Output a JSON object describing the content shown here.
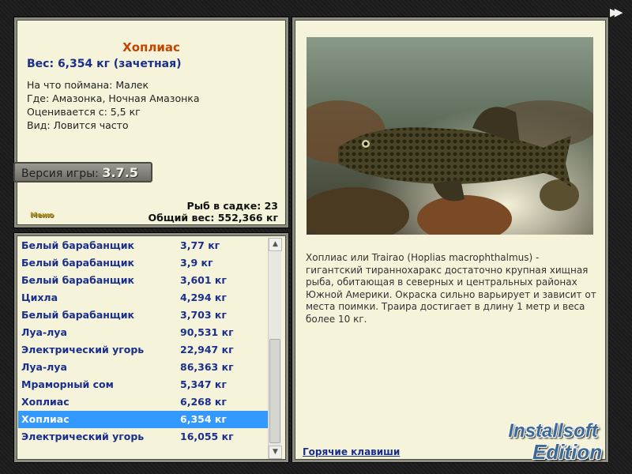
{
  "fish": {
    "name": "Хоплиас",
    "weight_line": "Вес: 6,354 кг (зачетная)",
    "caught_on": "На что поймана: Малек",
    "location": "Где: Амазонка, Ночная Амазонка",
    "valued_from": "Оценивается с: 5,5 кг",
    "kind": "Вид: Ловится часто"
  },
  "version": {
    "label": "Версия игры:",
    "number": "3.7.5"
  },
  "menu_label": "Меню",
  "stats": {
    "fish_in_tank": "Рыб в садке: 23",
    "total_weight": "Общий вес: 552,366 кг"
  },
  "catch_list": [
    {
      "name": "Белый барабанщик",
      "weight": "3,77 кг"
    },
    {
      "name": "Белый барабанщик",
      "weight": "3,9 кг"
    },
    {
      "name": "Белый барабанщик",
      "weight": "3,601 кг"
    },
    {
      "name": "Цихла",
      "weight": "4,294 кг"
    },
    {
      "name": "Белый барабанщик",
      "weight": "3,703 кг"
    },
    {
      "name": "Луа-луа",
      "weight": "90,531 кг"
    },
    {
      "name": "Электрический угорь",
      "weight": "22,947 кг"
    },
    {
      "name": "Луа-луа",
      "weight": "86,363 кг"
    },
    {
      "name": "Мраморный сом",
      "weight": "5,347 кг"
    },
    {
      "name": "Хоплиас",
      "weight": "6,268 кг"
    },
    {
      "name": "Хоплиас",
      "weight": "6,354 кг"
    },
    {
      "name": "Электрический угорь",
      "weight": "16,055 кг"
    }
  ],
  "selected_index": 10,
  "description": "Хоплиас или Trairao (Hoplias macrophthalmus) - гигантский тираннохаракс достаточно крупная хищная рыба, обитающая в северных и центральных районах Южной Америки. Окраска сильно варьирует и зависит от места поимки. Траира достигает в длину 1 метр и веса более 10 кг.",
  "hotkeys_link": "Горячие клавиши",
  "watermark": {
    "line1": "Installsoft",
    "line2": "Edition"
  },
  "colors": {
    "panel_bg": "#f5f3da",
    "title": "#c44400",
    "accent_blue": "#1a2f8c",
    "selection": "#3399ff"
  }
}
